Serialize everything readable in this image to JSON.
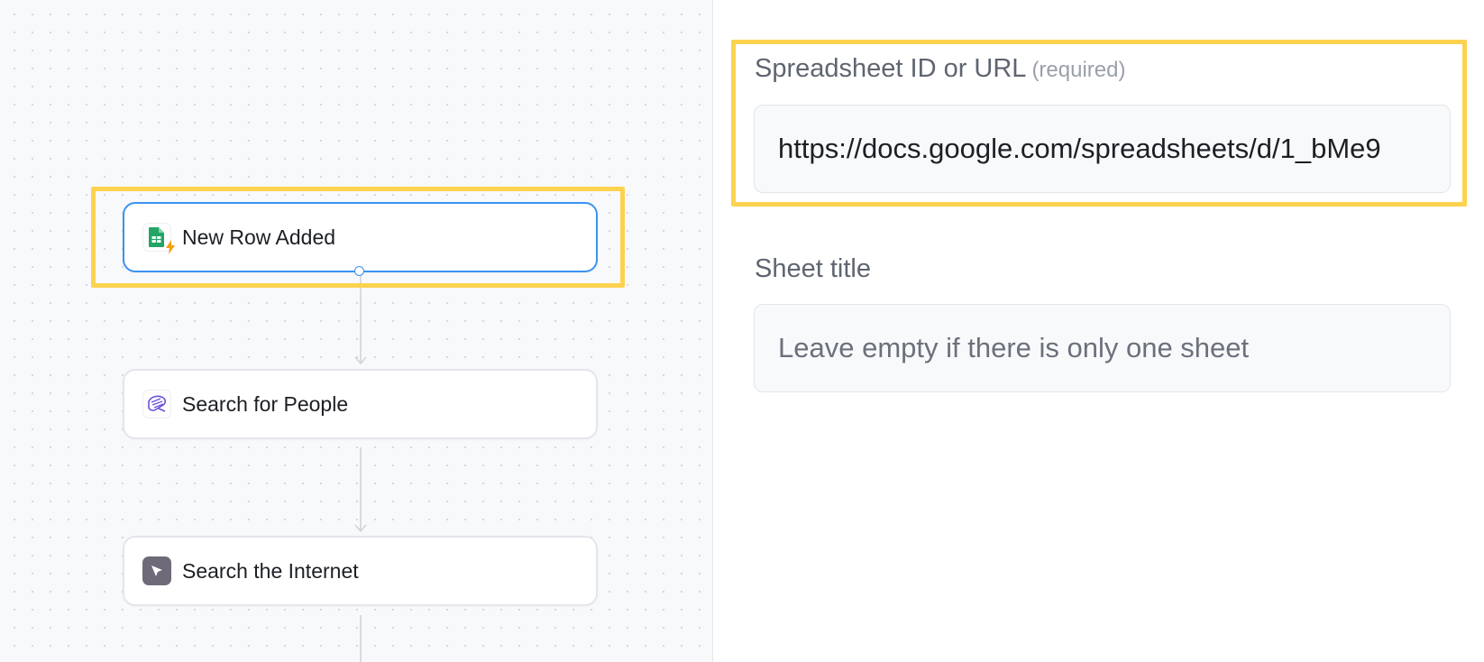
{
  "workflow": {
    "nodes": [
      {
        "label": "New Row Added",
        "icon": "google-sheets-trigger-icon"
      },
      {
        "label": "Search for People",
        "icon": "people-search-icon"
      },
      {
        "label": "Search the Internet",
        "icon": "internet-search-icon"
      }
    ]
  },
  "panel": {
    "spreadsheet": {
      "label": "Spreadsheet ID or URL",
      "required": "(required)",
      "value": "https://docs.google.com/spreadsheets/d/1_bMe9"
    },
    "sheet_title": {
      "label": "Sheet title",
      "placeholder": "Leave empty if there is only one sheet"
    }
  },
  "colors": {
    "highlight": "#fcd24f",
    "selected_border": "#3b93f0",
    "sheets_green": "#23a566",
    "trigger_orange": "#f59e0b",
    "people_purple": "#6d4fd8",
    "internet_gray": "#6f6a78"
  }
}
